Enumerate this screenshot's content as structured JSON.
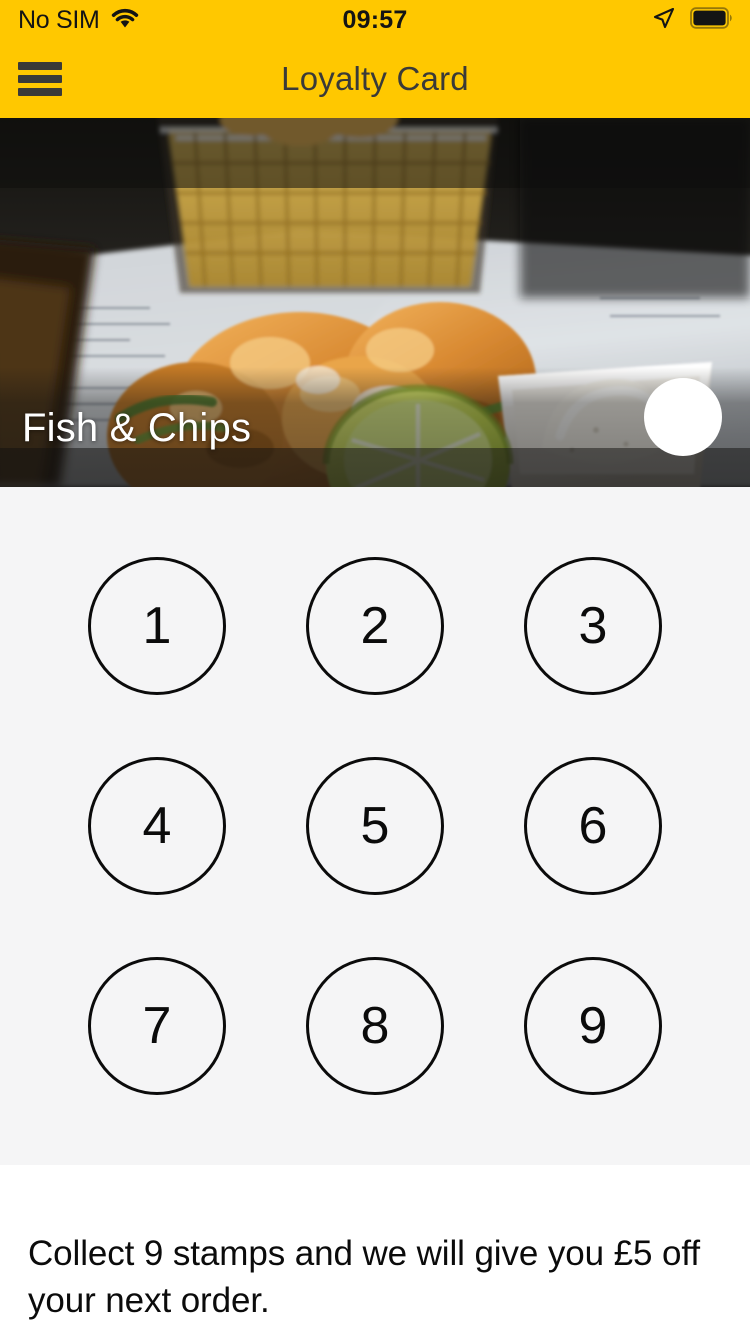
{
  "status_bar": {
    "carrier": "No SIM",
    "wifi_icon": "wifi-icon",
    "time": "09:57",
    "location_icon": "location-arrow-icon",
    "battery_icon": "battery-full-icon"
  },
  "nav_bar": {
    "menu_icon": "hamburger-menu-icon",
    "title": "Loyalty Card",
    "background_color": "#FFC800",
    "text_color": "#3A3A38"
  },
  "hero": {
    "image_alt": "fish-and-chips-photo",
    "title": "Fish & Chips",
    "share_icon": "share-icon"
  },
  "stamps": {
    "background_color": "#F5F5F6",
    "border_color": "#0B0B0B",
    "rows": [
      [
        "1",
        "2",
        "3"
      ],
      [
        "4",
        "5",
        "6"
      ],
      [
        "7",
        "8",
        "9"
      ]
    ]
  },
  "note": {
    "text": "Collect 9 stamps and we will give you £5 off your next order."
  }
}
